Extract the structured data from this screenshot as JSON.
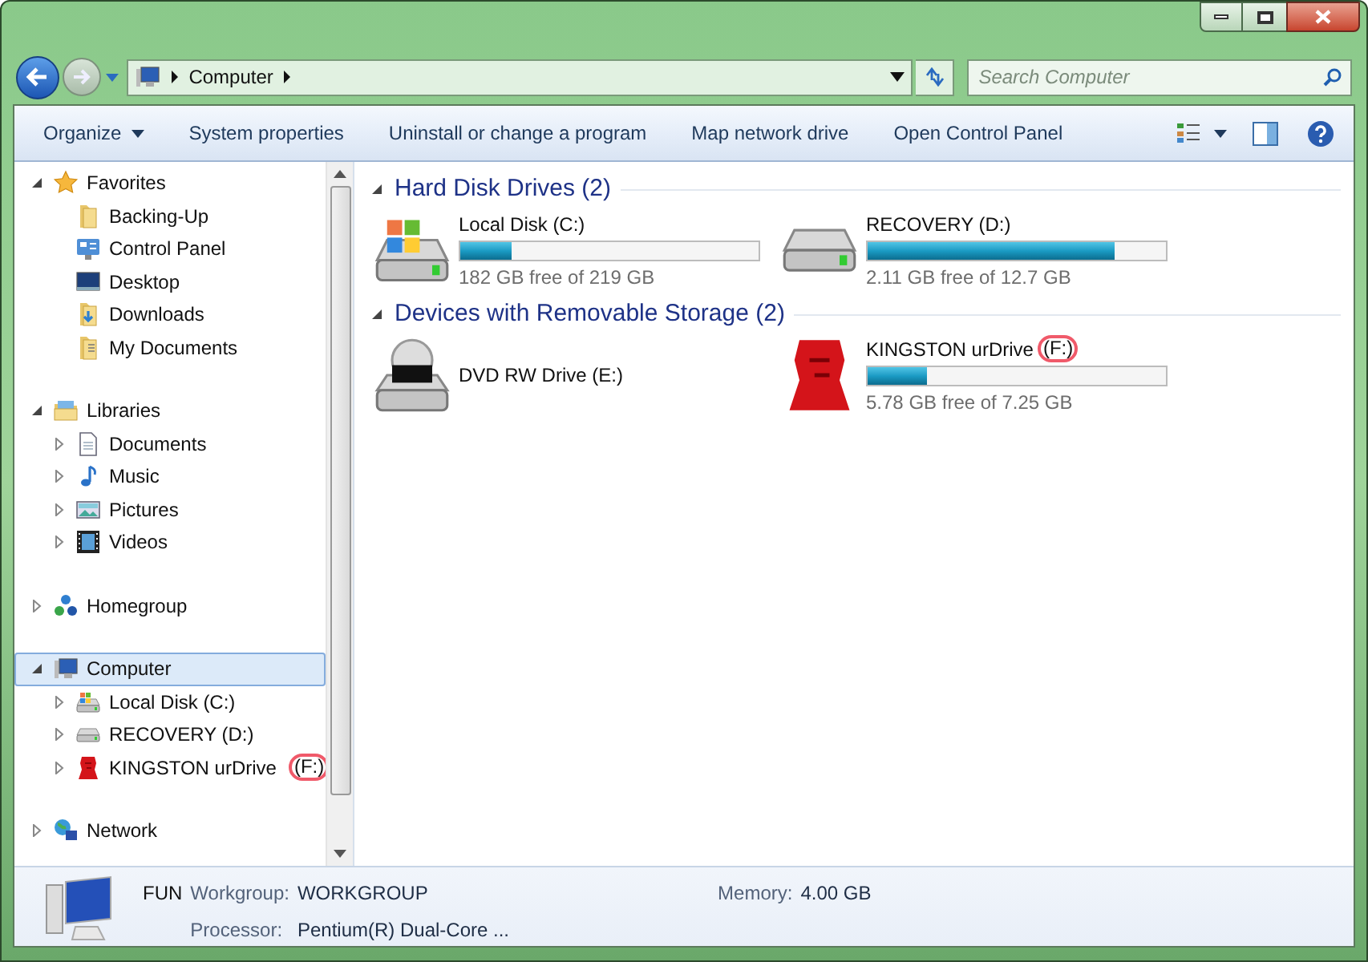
{
  "address_bar": {
    "path": [
      "Computer"
    ]
  },
  "search": {
    "placeholder": "Search Computer"
  },
  "toolbar": {
    "items": [
      {
        "label": "Organize",
        "dropdown": true
      },
      {
        "label": "System properties",
        "dropdown": false
      },
      {
        "label": "Uninstall or change a program",
        "dropdown": false
      },
      {
        "label": "Map network drive",
        "dropdown": false
      },
      {
        "label": "Open Control Panel",
        "dropdown": false
      }
    ]
  },
  "nav_tree": [
    {
      "label": "Favorites",
      "kind": "star",
      "expanded": true,
      "selected": false,
      "children": [
        {
          "label": "Backing-Up",
          "kind": "folder",
          "selected": false
        },
        {
          "label": "Control Panel",
          "kind": "control-panel",
          "selected": false
        },
        {
          "label": "Desktop",
          "kind": "desktop",
          "selected": false
        },
        {
          "label": "Downloads",
          "kind": "downloads",
          "selected": false
        },
        {
          "label": "My Documents",
          "kind": "documents",
          "selected": false
        }
      ]
    },
    {
      "label": "Libraries",
      "kind": "library",
      "expanded": true,
      "selected": false,
      "children": [
        {
          "label": "Documents",
          "kind": "document",
          "expanded": false,
          "selected": false
        },
        {
          "label": "Music",
          "kind": "music",
          "expanded": false,
          "selected": false
        },
        {
          "label": "Pictures",
          "kind": "pictures",
          "expanded": false,
          "selected": false
        },
        {
          "label": "Videos",
          "kind": "videos",
          "expanded": false,
          "selected": false
        }
      ]
    },
    {
      "label": "Homegroup",
      "kind": "homegroup",
      "expanded": false,
      "selected": false
    },
    {
      "label": "Computer",
      "kind": "computer",
      "expanded": true,
      "selected": true,
      "children": [
        {
          "label": "Local Disk (C:)",
          "kind": "hdd-windows",
          "expanded": false,
          "selected": false
        },
        {
          "label": "RECOVERY (D:)",
          "kind": "hdd",
          "expanded": false,
          "selected": false
        },
        {
          "label": "KINGSTON urDrive",
          "letter": "(F:)",
          "circled": true,
          "kind": "kingston",
          "expanded": false,
          "selected": false
        }
      ]
    },
    {
      "label": "Network",
      "kind": "network",
      "expanded": false,
      "selected": false
    }
  ],
  "groups": [
    {
      "title": "Hard Disk Drives (2)",
      "expanded": true,
      "items": [
        {
          "name": "Local Disk (C:)",
          "kind": "hdd-windows",
          "level": 0.17,
          "reading": "182 GB free of 219 GB"
        },
        {
          "name": "RECOVERY (D:)",
          "kind": "hdd",
          "level": 0.83,
          "reading": "2.11 GB free of 12.7 GB"
        }
      ]
    },
    {
      "title": "Devices with Removable Storage (2)",
      "expanded": true,
      "items": [
        {
          "name": "DVD RW Drive (E:)",
          "kind": "dvd"
        },
        {
          "name": "KINGSTON urDrive",
          "letter": "(F:)",
          "circled": true,
          "kind": "kingston",
          "level": 0.2,
          "reading": "5.78 GB free of 7.25 GB"
        }
      ]
    }
  ],
  "details": {
    "name": "FUN",
    "fields": [
      {
        "label": "Workgroup:",
        "value": "WORKGROUP"
      },
      {
        "label": "Memory:",
        "value": "4.00 GB"
      },
      {
        "label": "Processor:",
        "value": "Pentium(R) Dual-Core ..."
      }
    ]
  }
}
